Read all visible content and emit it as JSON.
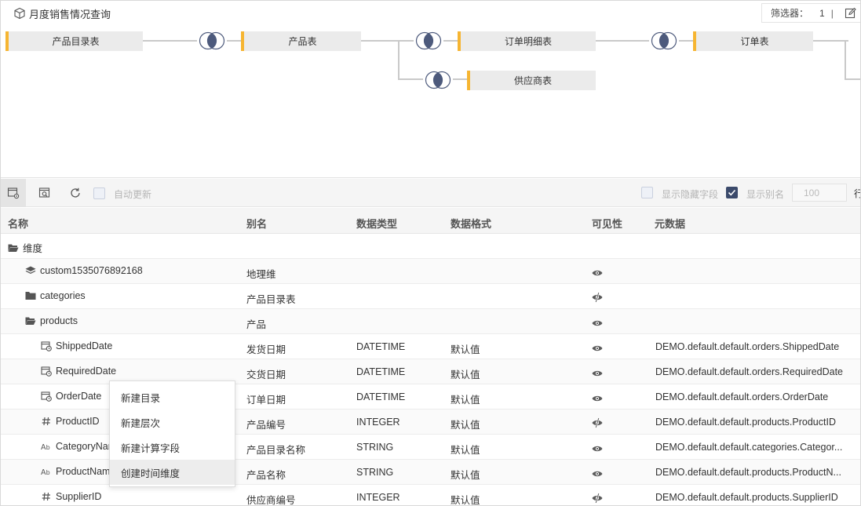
{
  "canvas": {
    "title": "月度销售情况查询",
    "filter": {
      "label": "筛选器：",
      "count": "1",
      "separator": "|"
    },
    "tables": [
      {
        "id": "t1",
        "label": "产品目录表"
      },
      {
        "id": "t2",
        "label": "产品表"
      },
      {
        "id": "t3",
        "label": "订单明细表"
      },
      {
        "id": "t4",
        "label": "订单表"
      },
      {
        "id": "t5",
        "label": "供应商表"
      }
    ]
  },
  "toolbar": {
    "auto_update_label": "自动更新",
    "show_hidden_label": "显示隐藏字段",
    "show_alias_label": "显示别名",
    "show_alias_checked": true,
    "rows_value": "100",
    "rows_suffix": "行"
  },
  "grid": {
    "headers": [
      "名称",
      "别名",
      "数据类型",
      "数据格式",
      "可见性",
      "元数据"
    ],
    "rows": [
      {
        "indent": 0,
        "icon": "folder-open-icon",
        "name": "维度",
        "alias": "",
        "type": "",
        "format": "",
        "visibility": "",
        "meta": ""
      },
      {
        "indent": 1,
        "icon": "layers-icon",
        "name": "custom1535076892168",
        "alias": "地理维",
        "type": "",
        "format": "",
        "visibility": "visible",
        "meta": ""
      },
      {
        "indent": 1,
        "icon": "folder-icon",
        "name": "categories",
        "alias": "产品目录表",
        "type": "",
        "format": "",
        "visibility": "hidden",
        "meta": ""
      },
      {
        "indent": 1,
        "icon": "folder-open-icon",
        "name": "products",
        "alias": "产品",
        "type": "",
        "format": "",
        "visibility": "visible",
        "meta": ""
      },
      {
        "indent": 2,
        "icon": "calendar-clock-icon",
        "name": "ShippedDate",
        "alias": "发货日期",
        "type": "DATETIME",
        "format": "默认值",
        "visibility": "visible",
        "meta": "DEMO.default.default.orders.ShippedDate"
      },
      {
        "indent": 2,
        "icon": "calendar-clock-icon",
        "name": "RequiredDate",
        "alias": "交货日期",
        "type": "DATETIME",
        "format": "默认值",
        "visibility": "visible",
        "meta": "DEMO.default.default.orders.RequiredDate"
      },
      {
        "indent": 2,
        "icon": "calendar-clock-icon",
        "name": "OrderDate",
        "alias": "订单日期",
        "type": "DATETIME",
        "format": "默认值",
        "visibility": "visible",
        "meta": "DEMO.default.default.orders.OrderDate"
      },
      {
        "indent": 2,
        "icon": "hash-icon",
        "name": "ProductID",
        "alias": "产品编号",
        "type": "INTEGER",
        "format": "默认值",
        "visibility": "hidden",
        "meta": "DEMO.default.default.products.ProductID"
      },
      {
        "indent": 2,
        "icon": "text-ab-icon",
        "name": "CategoryNar",
        "alias": "产品目录名称",
        "type": "STRING",
        "format": "默认值",
        "visibility": "visible",
        "meta": "DEMO.default.default.categories.Categor..."
      },
      {
        "indent": 2,
        "icon": "text-ab-icon",
        "name": "ProductNam",
        "alias": "产品名称",
        "type": "STRING",
        "format": "默认值",
        "visibility": "visible",
        "meta": "DEMO.default.default.products.ProductN..."
      },
      {
        "indent": 2,
        "icon": "hash-icon",
        "name": "SupplierID",
        "alias": "供应商编号",
        "type": "INTEGER",
        "format": "默认值",
        "visibility": "hidden",
        "meta": "DEMO.default.default.products.SupplierID"
      }
    ]
  },
  "context_menu": {
    "items": [
      "新建目录",
      "新建层次",
      "新建计算字段",
      "创建时间维度"
    ],
    "highlighted_index": 3
  }
}
